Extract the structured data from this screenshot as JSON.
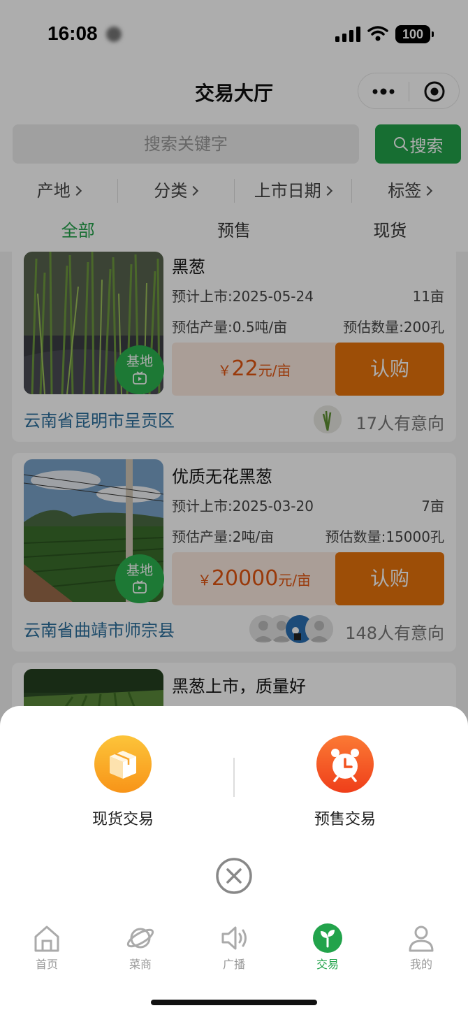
{
  "status_bar": {
    "time": "16:08",
    "battery": "100"
  },
  "nav": {
    "title": "交易大厅"
  },
  "search": {
    "placeholder": "搜索关键字",
    "button_label": "搜索"
  },
  "filters": [
    "产地",
    "分类",
    "上市日期",
    "标签"
  ],
  "tabs": [
    {
      "label": "全部",
      "active": true
    },
    {
      "label": "预售",
      "active": false
    },
    {
      "label": "现货",
      "active": false
    }
  ],
  "listings": [
    {
      "title": "黑葱",
      "listing_date": "预计上市:2025-05-24",
      "area": "11亩",
      "yield": "预估产量:0.5吨/亩",
      "quantity": "预估数量:200孔",
      "price_currency": "￥",
      "price": "22",
      "price_unit": "元/亩",
      "buy_label": "认购",
      "badge": "基地",
      "location": "云南省昆明市呈贡区",
      "interest": "17人有意向"
    },
    {
      "title": "优质无花黑葱",
      "listing_date": "预计上市:2025-03-20",
      "area": "7亩",
      "yield": "预估产量:2吨/亩",
      "quantity": "预估数量:15000孔",
      "price_currency": "￥",
      "price": "20000",
      "price_unit": "元/亩",
      "buy_label": "认购",
      "badge": "基地",
      "location": "云南省曲靖市师宗县",
      "interest": "148人有意向"
    },
    {
      "title": "黑葱上市，质量好"
    }
  ],
  "sheet": {
    "options": [
      {
        "label": "现货交易",
        "icon": "box-icon",
        "color": "#f9a21f"
      },
      {
        "label": "预售交易",
        "icon": "alarm-clock-icon",
        "color": "#f2521f"
      }
    ]
  },
  "tabbar": [
    {
      "label": "首页",
      "icon": "home-icon",
      "active": false
    },
    {
      "label": "菜商",
      "icon": "planet-icon",
      "active": false
    },
    {
      "label": "广播",
      "icon": "speaker-icon",
      "active": false
    },
    {
      "label": "交易",
      "icon": "sprout-icon",
      "active": true
    },
    {
      "label": "我的",
      "icon": "user-icon",
      "active": false
    }
  ],
  "colors": {
    "brand_green": "#22a34b",
    "buy_orange": "#e8730b",
    "price_red": "#e2540f",
    "location_blue": "#2c6f9c"
  }
}
